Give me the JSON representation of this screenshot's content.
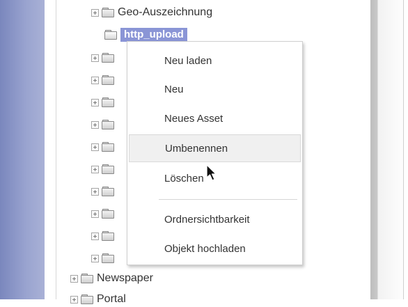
{
  "tree": {
    "items": [
      {
        "label": "Geo-Auszeichnung",
        "expandable": true
      },
      {
        "label": "http_upload",
        "selected": true,
        "open": true
      },
      {
        "label": "",
        "expandable": true
      },
      {
        "label": "",
        "expandable": true
      },
      {
        "label": "",
        "expandable": true
      },
      {
        "label": "",
        "expandable": true
      },
      {
        "label": "",
        "expandable": true
      },
      {
        "label": "",
        "expandable": true
      },
      {
        "label": "",
        "expandable": true
      },
      {
        "label": "",
        "expandable": true
      },
      {
        "label": "",
        "expandable": true
      },
      {
        "label": "",
        "expandable": true
      },
      {
        "label": "Newspaper",
        "expandable": true
      },
      {
        "label": "Portal",
        "expandable": true
      }
    ]
  },
  "context_menu": {
    "items": [
      {
        "label": "Neu laden"
      },
      {
        "label": "Neu"
      },
      {
        "label": "Neues Asset"
      },
      {
        "label": "Umbenennen",
        "hovered": true
      },
      {
        "label": "Löschen"
      },
      {
        "label": "Ordnersichtbarkeit"
      },
      {
        "label": "Objekt hochladen"
      }
    ]
  },
  "colors": {
    "selection": "#8a95d6",
    "left_strip": "#8f99c9",
    "menu_hover": "#f0f0f0"
  },
  "icons": {
    "expand": "plus-expander-icon",
    "folder": "folder-icon",
    "cursor": "mouse-pointer-icon"
  }
}
